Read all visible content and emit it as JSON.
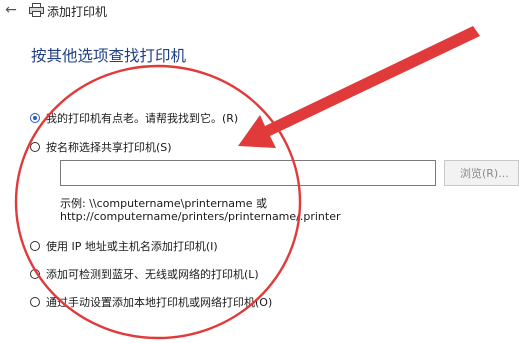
{
  "window": {
    "title": "添加打印机",
    "back_glyph": "←"
  },
  "page": {
    "heading": "按其他选项查找打印机"
  },
  "options": [
    {
      "label": "我的打印机有点老。请帮我找到它。(R)",
      "selected": true
    },
    {
      "label": "按名称选择共享打印机(S)",
      "selected": false
    },
    {
      "label": "使用 IP 地址或主机名添加打印机(I)",
      "selected": false
    },
    {
      "label": "添加可检测到蓝牙、无线或网络的打印机(L)",
      "selected": false
    },
    {
      "label": "通过手动设置添加本地打印机或网络打印机(O)",
      "selected": false
    }
  ],
  "share_name": {
    "value": "",
    "browse_label": "浏览(R)...",
    "example_line1": "示例: \\\\computername\\printername 或",
    "example_line2": "http://computername/printers/printername/.printer"
  },
  "colors": {
    "heading": "#1f3f86",
    "annotation_red": "#e03a3a",
    "radio_selected": "#1f5fbf"
  }
}
